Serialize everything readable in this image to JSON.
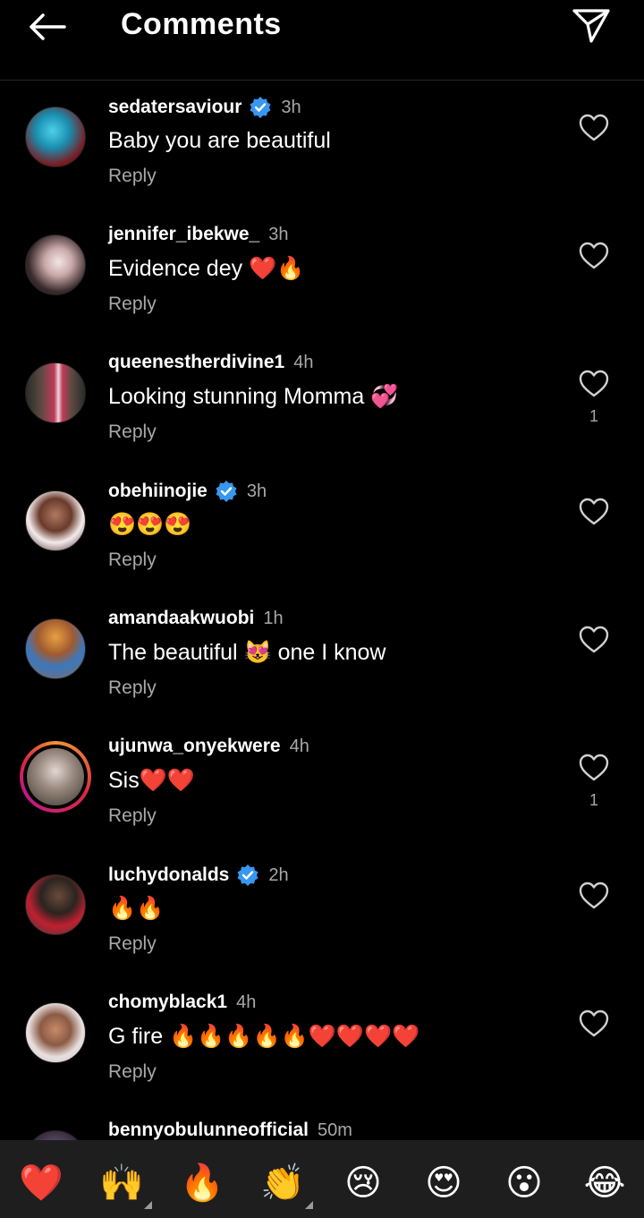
{
  "header": {
    "title": "Comments",
    "back_icon": "arrow-left-icon",
    "share_icon": "paper-plane-icon"
  },
  "comments": [
    {
      "username": "sedatersaviour",
      "verified": true,
      "time": "3h",
      "text": "Baby you are beautiful",
      "reply": "Reply",
      "likes": ""
    },
    {
      "username": "jennifer_ibekwe_",
      "verified": false,
      "time": "3h",
      "text": "Evidence dey ❤️🔥",
      "reply": "Reply",
      "likes": ""
    },
    {
      "username": "queenestherdivine1",
      "verified": false,
      "time": "4h",
      "text": "Looking stunning Momma 💞",
      "reply": "Reply",
      "likes": "1"
    },
    {
      "username": "obehiinojie",
      "verified": true,
      "time": "3h",
      "text": "😍😍😍",
      "reply": "Reply",
      "likes": ""
    },
    {
      "username": "amandaakwuobi",
      "verified": false,
      "time": "1h",
      "text": "The beautiful 😻 one I know",
      "reply": "Reply",
      "likes": ""
    },
    {
      "username": "ujunwa_onyekwere",
      "verified": false,
      "time": "4h",
      "text": "Sis❤️❤️",
      "reply": "Reply",
      "likes": "1"
    },
    {
      "username": "luchydonalds",
      "verified": true,
      "time": "2h",
      "text": "🔥🔥",
      "reply": "Reply",
      "likes": ""
    },
    {
      "username": "chomyblack1",
      "verified": false,
      "time": "4h",
      "text": "G fire 🔥🔥🔥🔥🔥❤️❤️❤️❤️",
      "reply": "Reply",
      "likes": ""
    },
    {
      "username": "bennyobulunneofficial",
      "verified": false,
      "time": "50m",
      "text": "",
      "reply": "",
      "likes": ""
    }
  ],
  "reactions": [
    "❤️",
    "🙌",
    "🔥",
    "👏",
    "😢",
    "😍",
    "😮",
    "😂"
  ],
  "colors": {
    "background": "#000000",
    "secondary_text": "#a8a8a8",
    "verified_blue": "#3897f0",
    "reaction_bar": "#1e1e1e"
  }
}
